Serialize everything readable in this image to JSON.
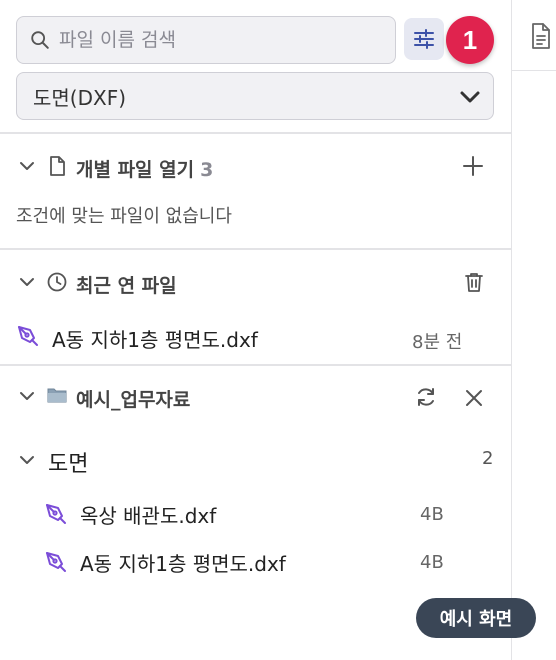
{
  "search": {
    "placeholder": "파일 이름 검색",
    "value": ""
  },
  "badge": {
    "number": "1"
  },
  "format_select": {
    "selected": "도면(DXF)"
  },
  "individual_files": {
    "title": "개별 파일 열기",
    "count": "3",
    "empty_message": "조건에 맞는 파일이 없습니다"
  },
  "recent_files": {
    "title": "최근 연 파일",
    "items": [
      {
        "name": "A동 지하1층 평면도.dxf",
        "time": "8분 전"
      }
    ]
  },
  "folder": {
    "title": "예시_업무자료",
    "groups": [
      {
        "name": "도면",
        "count": "2",
        "items": [
          {
            "name": "옥상 배관도.dxf",
            "size": "4B"
          },
          {
            "name": "A동 지하1층 평면도.dxf",
            "size": "4B"
          }
        ]
      }
    ]
  },
  "toast": {
    "label": "예시 화면"
  },
  "colors": {
    "accent_badge": "#e0234e",
    "file_icon": "#7b4dd8",
    "toast_bg": "#3a4656"
  },
  "icons": [
    "search-icon",
    "filter-icon",
    "chevron-down-icon",
    "file-icon",
    "plus-icon",
    "clock-icon",
    "trash-icon",
    "pen-tool-icon",
    "folder-icon",
    "refresh-icon",
    "close-icon",
    "document-icon"
  ]
}
